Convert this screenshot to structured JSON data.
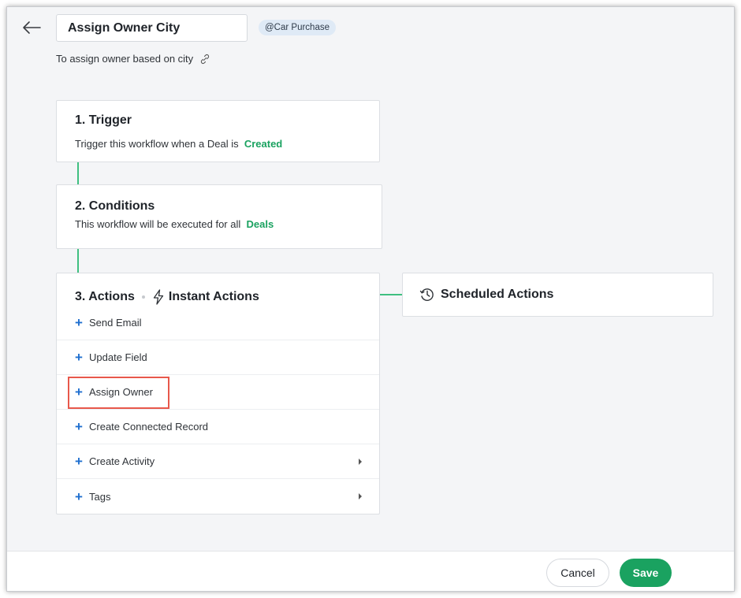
{
  "header": {
    "workflow_name": "Assign Owner City",
    "module_badge": "@Car Purchase",
    "description": "To assign owner based on city"
  },
  "trigger": {
    "title": "1. Trigger",
    "text": "Trigger this workflow when a Deal is",
    "value": "Created"
  },
  "conditions": {
    "title": "2. Conditions",
    "text": "This workflow will be executed for all",
    "value": "Deals"
  },
  "actions": {
    "title": "3. Actions",
    "instant_label": "Instant Actions",
    "items": [
      {
        "label": "Send Email"
      },
      {
        "label": "Update Field"
      },
      {
        "label": "Assign Owner"
      },
      {
        "label": "Create Connected Record"
      },
      {
        "label": "Create Activity"
      },
      {
        "label": "Tags"
      }
    ]
  },
  "scheduled": {
    "label": "Scheduled Actions"
  },
  "footer": {
    "cancel_label": "Cancel",
    "save_label": "Save"
  },
  "colors": {
    "accent_green": "#1aa260",
    "plus_blue": "#1f6fcf",
    "highlight_red": "#e8584b"
  }
}
